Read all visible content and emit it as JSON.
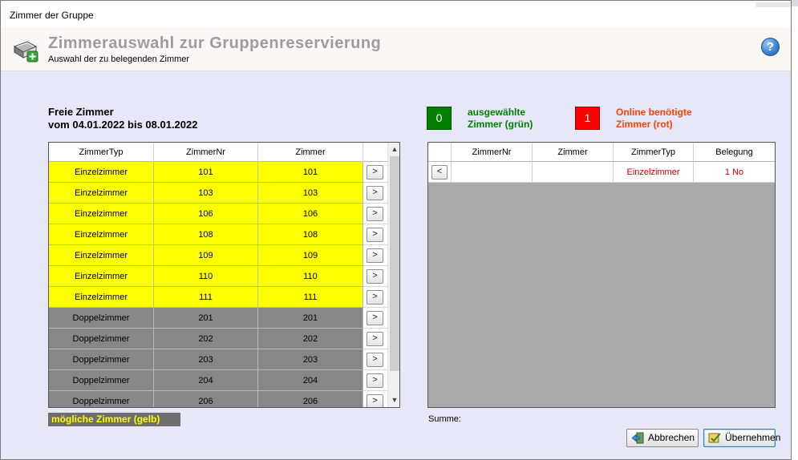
{
  "window": {
    "title": "Zimmer der Gruppe"
  },
  "header": {
    "title": "Zimmerauswahl zur Gruppenreservierung",
    "subtitle": "Auswahl der zu belegenden Zimmer",
    "help_icon": "question-mark-icon",
    "help_glyph": "?"
  },
  "free_rooms": {
    "title": "Freie Zimmer",
    "range": "vom 04.01.2022 bis 08.01.2022",
    "columns": [
      "ZimmerTyp",
      "ZimmerNr",
      "Zimmer"
    ],
    "rows": [
      {
        "typ": "Einzelzimmer",
        "nr": "101",
        "zimmer": "101",
        "highlight": "yellow"
      },
      {
        "typ": "Einzelzimmer",
        "nr": "103",
        "zimmer": "103",
        "highlight": "yellow"
      },
      {
        "typ": "Einzelzimmer",
        "nr": "106",
        "zimmer": "106",
        "highlight": "yellow"
      },
      {
        "typ": "Einzelzimmer",
        "nr": "108",
        "zimmer": "108",
        "highlight": "yellow"
      },
      {
        "typ": "Einzelzimmer",
        "nr": "109",
        "zimmer": "109",
        "highlight": "yellow"
      },
      {
        "typ": "Einzelzimmer",
        "nr": "110",
        "zimmer": "110",
        "highlight": "yellow"
      },
      {
        "typ": "Einzelzimmer",
        "nr": "111",
        "zimmer": "111",
        "highlight": "yellow"
      },
      {
        "typ": "Doppelzimmer",
        "nr": "201",
        "zimmer": "201",
        "highlight": "gray"
      },
      {
        "typ": "Doppelzimmer",
        "nr": "202",
        "zimmer": "202",
        "highlight": "gray"
      },
      {
        "typ": "Doppelzimmer",
        "nr": "203",
        "zimmer": "203",
        "highlight": "gray"
      },
      {
        "typ": "Doppelzimmer",
        "nr": "204",
        "zimmer": "204",
        "highlight": "gray"
      },
      {
        "typ": "Doppelzimmer",
        "nr": "206",
        "zimmer": "206",
        "highlight": "gray"
      }
    ],
    "add_button_label": ">",
    "legend": "mögliche Zimmer (gelb)",
    "scroll_up_glyph": "▲",
    "scroll_down_glyph": "▼"
  },
  "counters": {
    "selected_count": "0",
    "selected_label_1": "ausgewählte",
    "selected_label_2": "Zimmer (grün)",
    "needed_count": "1",
    "needed_label_1": "Online benötigte",
    "needed_label_2": "Zimmer (rot)"
  },
  "selected_rooms": {
    "columns": [
      "ZimmerNr",
      "Zimmer",
      "ZimmerTyp",
      "Belegung"
    ],
    "rows": [
      {
        "nr": "",
        "zimmer": "",
        "typ": "Einzelzimmer",
        "belegung": "1 No"
      }
    ],
    "remove_button_label": "<",
    "sum_label": "Summe:"
  },
  "buttons": {
    "cancel_label": "Abbrechen",
    "apply_label": "Übernehmen"
  },
  "colors": {
    "selected_green": "#008000",
    "needed_red": "#ff0000",
    "possible_yellow": "#ffff00",
    "unavailable_gray": "#878787"
  }
}
